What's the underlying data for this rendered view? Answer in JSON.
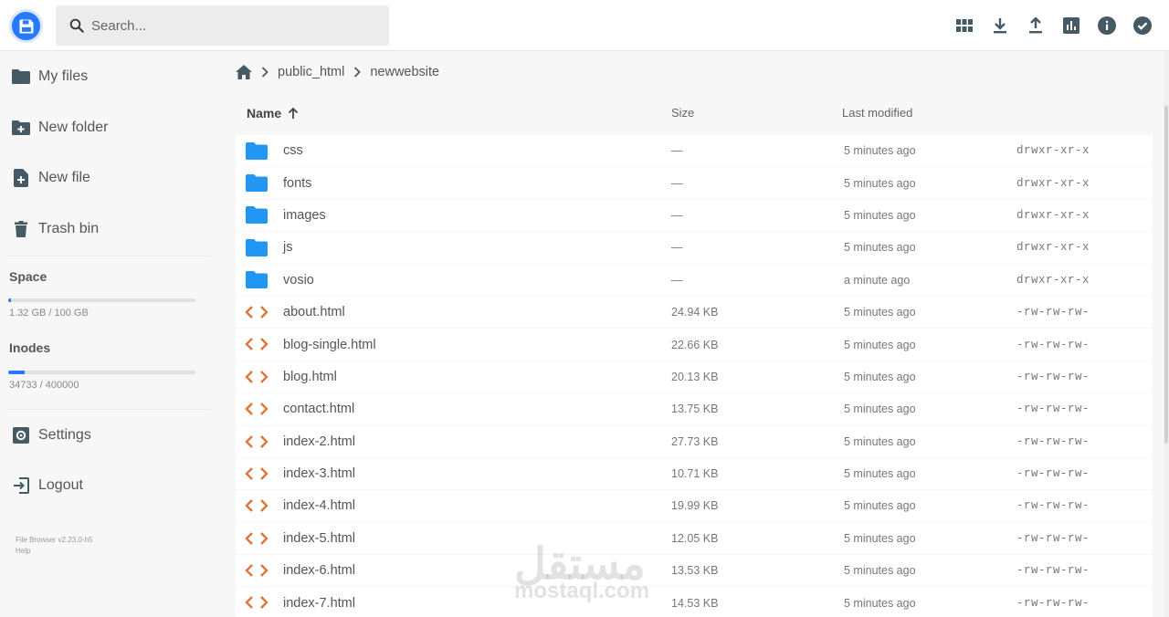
{
  "header": {
    "search_placeholder": "Search...",
    "actions": [
      {
        "name": "grid-view-icon"
      },
      {
        "name": "download-icon"
      },
      {
        "name": "upload-icon"
      },
      {
        "name": "chart-icon"
      },
      {
        "name": "info-icon"
      },
      {
        "name": "check-circle-icon"
      }
    ]
  },
  "sidebar": {
    "my_files": "My files",
    "new_folder": "New folder",
    "new_file": "New file",
    "trash_bin": "Trash bin",
    "space_title": "Space",
    "space_text": "1.32 GB / 100 GB",
    "space_used_fraction": 0.0132,
    "inodes_title": "Inodes",
    "inodes_text": "34733 / 400000",
    "inodes_used_fraction": 0.0868,
    "settings": "Settings",
    "logout": "Logout",
    "version": "File Browser v2.23.0-h5",
    "help": "Help"
  },
  "breadcrumb": {
    "home_icon": "home-icon",
    "items": [
      "public_html",
      "newwebsite"
    ]
  },
  "table": {
    "col_name": "Name",
    "col_size": "Size",
    "col_modified": "Last modified",
    "rows": [
      {
        "type": "folder",
        "name": "css",
        "size": "—",
        "modified": "5 minutes ago",
        "perm": "drwxr-xr-x"
      },
      {
        "type": "folder",
        "name": "fonts",
        "size": "—",
        "modified": "5 minutes ago",
        "perm": "drwxr-xr-x"
      },
      {
        "type": "folder",
        "name": "images",
        "size": "—",
        "modified": "5 minutes ago",
        "perm": "drwxr-xr-x"
      },
      {
        "type": "folder",
        "name": "js",
        "size": "—",
        "modified": "5 minutes ago",
        "perm": "drwxr-xr-x"
      },
      {
        "type": "folder",
        "name": "vosio",
        "size": "—",
        "modified": "a minute ago",
        "perm": "drwxr-xr-x"
      },
      {
        "type": "code",
        "name": "about.html",
        "size": "24.94 KB",
        "modified": "5 minutes ago",
        "perm": "-rw-rw-rw-"
      },
      {
        "type": "code",
        "name": "blog-single.html",
        "size": "22.66 KB",
        "modified": "5 minutes ago",
        "perm": "-rw-rw-rw-"
      },
      {
        "type": "code",
        "name": "blog.html",
        "size": "20.13 KB",
        "modified": "5 minutes ago",
        "perm": "-rw-rw-rw-"
      },
      {
        "type": "code",
        "name": "contact.html",
        "size": "13.75 KB",
        "modified": "5 minutes ago",
        "perm": "-rw-rw-rw-"
      },
      {
        "type": "code",
        "name": "index-2.html",
        "size": "27.73 KB",
        "modified": "5 minutes ago",
        "perm": "-rw-rw-rw-"
      },
      {
        "type": "code",
        "name": "index-3.html",
        "size": "10.71 KB",
        "modified": "5 minutes ago",
        "perm": "-rw-rw-rw-"
      },
      {
        "type": "code",
        "name": "index-4.html",
        "size": "19.99 KB",
        "modified": "5 minutes ago",
        "perm": "-rw-rw-rw-"
      },
      {
        "type": "code",
        "name": "index-5.html",
        "size": "12.05 KB",
        "modified": "5 minutes ago",
        "perm": "-rw-rw-rw-"
      },
      {
        "type": "code",
        "name": "index-6.html",
        "size": "13.53 KB",
        "modified": "5 minutes ago",
        "perm": "-rw-rw-rw-"
      },
      {
        "type": "code",
        "name": "index-7.html",
        "size": "14.53 KB",
        "modified": "5 minutes ago",
        "perm": "-rw-rw-rw-"
      }
    ]
  },
  "watermark": {
    "arabic": "مستقل",
    "latin": "mostaql.com"
  },
  "colors": {
    "accent": "#2979ff",
    "folder": "#2196f3",
    "code": "#e0753a",
    "icon_dark": "#546e7a"
  }
}
